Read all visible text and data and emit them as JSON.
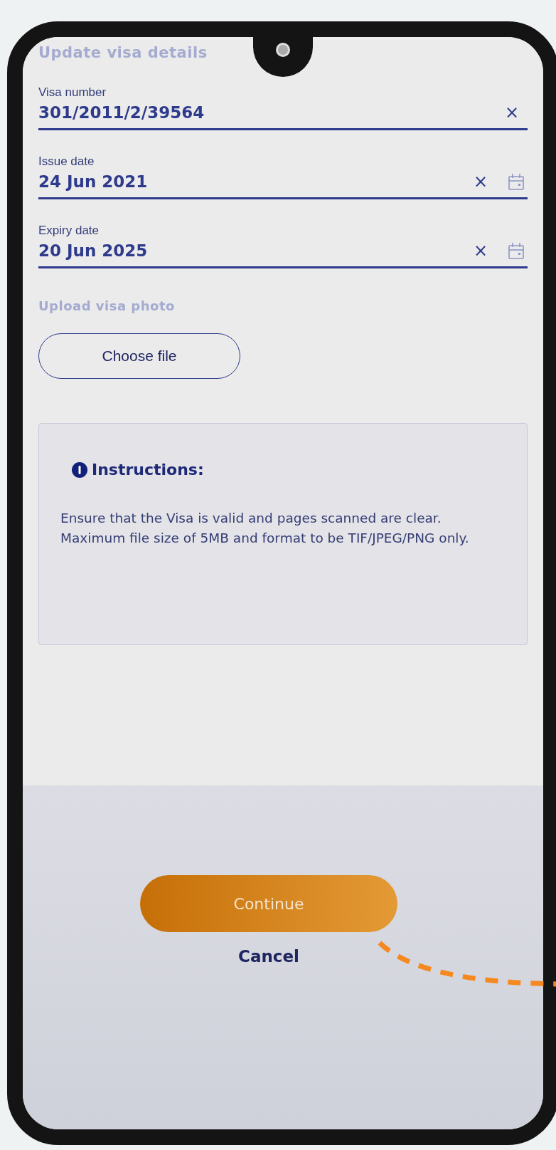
{
  "screen": {
    "title": "Update visa details"
  },
  "fields": [
    {
      "kind": "text",
      "label": "Visa number",
      "value": "301/2011/2/39564",
      "clear_icon": "×"
    },
    {
      "kind": "date",
      "label": "Issue date",
      "value": "24 Jun 2021",
      "clear_icon": "×"
    },
    {
      "kind": "date",
      "label": "Expiry date",
      "value": "20 Jun 2025",
      "clear_icon": "×"
    }
  ],
  "upload": {
    "label": "Upload visa photo",
    "button": "Choose file"
  },
  "instructions": {
    "title": "Instructions:",
    "text": "Ensure that the Visa is valid and pages scanned are clear. Maximum file size of 5MB and format to be TIF/JPEG/PNG only."
  },
  "actions": {
    "primary": "Continue",
    "secondary": "Cancel"
  }
}
